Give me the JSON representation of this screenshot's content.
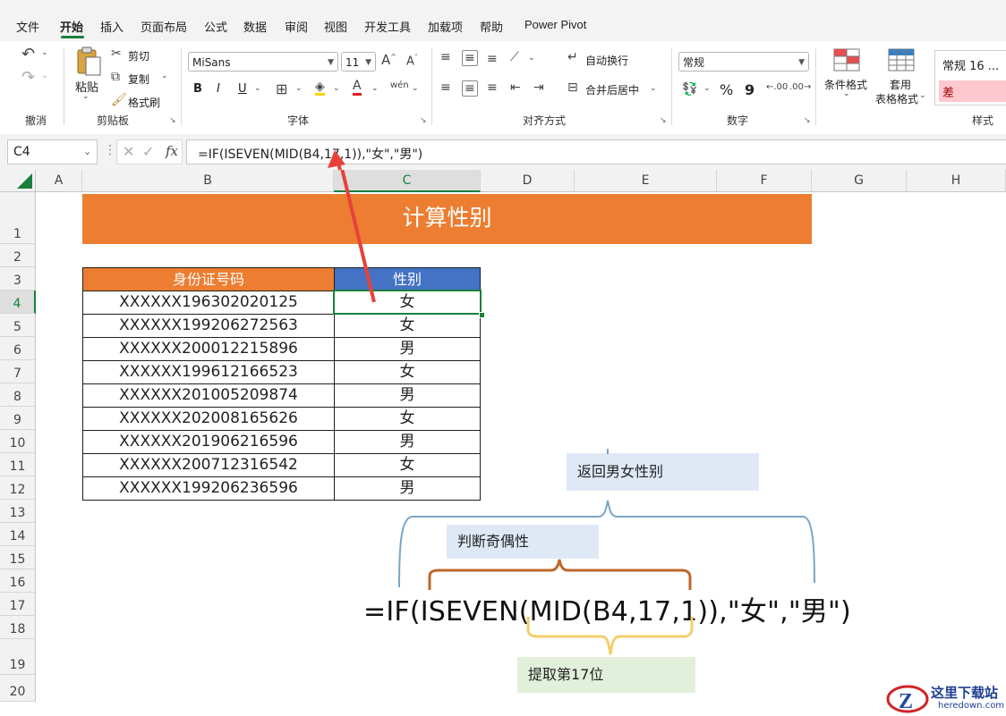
{
  "menu": {
    "tabs": [
      "文件",
      "开始",
      "插入",
      "页面布局",
      "公式",
      "数据",
      "审阅",
      "视图",
      "开发工具",
      "加载项",
      "帮助",
      "Power Pivot"
    ],
    "active": "开始"
  },
  "ribbon": {
    "undo_group": "撤消",
    "clipboard": {
      "paste": "粘贴",
      "cut": "剪切",
      "copy": "复制",
      "format_painter": "格式刷",
      "label": "剪贴板"
    },
    "font": {
      "name": "MiSans",
      "size": "11",
      "bold": "B",
      "italic": "I",
      "underline": "U",
      "label": "字体"
    },
    "alignment": {
      "wrap": "自动换行",
      "merge": "合并后居中",
      "label": "对齐方式"
    },
    "number": {
      "format": "常规",
      "percent": "%",
      "comma": "9",
      "label": "数字"
    },
    "styles": {
      "conditional": "条件格式",
      "table_line1": "套用",
      "table_line2": "表格格式",
      "normal_style": "常规 16 ...",
      "bad_style": "差",
      "label": "样式"
    }
  },
  "formula_bar": {
    "name_box": "C4",
    "fx": "fx",
    "formula": "=IF(ISEVEN(MID(B4,17,1)),\"女\",\"男\")"
  },
  "columns": [
    "A",
    "B",
    "C",
    "D",
    "E",
    "F",
    "G",
    "H"
  ],
  "rows": [
    "1",
    "2",
    "3",
    "4",
    "5",
    "6",
    "7",
    "8",
    "9",
    "10",
    "11",
    "12",
    "13",
    "14",
    "15",
    "16",
    "17",
    "18",
    "19",
    "20"
  ],
  "sheet": {
    "title": "计算性别",
    "header_id": "身份证号码",
    "header_gender": "性别",
    "records": [
      {
        "id": "XXXXXX196302020125",
        "gender": "女"
      },
      {
        "id": "XXXXXX199206272563",
        "gender": "女"
      },
      {
        "id": "XXXXXX200012215896",
        "gender": "男"
      },
      {
        "id": "XXXXXX199612166523",
        "gender": "女"
      },
      {
        "id": "XXXXXX201005209874",
        "gender": "男"
      },
      {
        "id": "XXXXXX202008165626",
        "gender": "女"
      },
      {
        "id": "XXXXXX201906216596",
        "gender": "男"
      },
      {
        "id": "XXXXXX200712316542",
        "gender": "女"
      },
      {
        "id": "XXXXXX199206236596",
        "gender": "男"
      }
    ]
  },
  "annotations": {
    "return_gender": "返回男女性别",
    "parity": "判断奇偶性",
    "extract": "提取第17位",
    "formula": "=IF(ISEVEN(MID(B4,17,1)),\"女\",\"男\")"
  },
  "watermark": {
    "name": "这里下载站",
    "url": "heredown.com"
  },
  "colors": {
    "title_bg": "#ed7d31",
    "header_id_bg": "#ed7d31",
    "header_gender_bg": "#4472c4",
    "accent_green": "#1a7f3c",
    "arrow_red": "#e8413a",
    "callout_blue_bg": "#dfe9f5",
    "callout_green_bg": "#e2efda",
    "brace_blue": "#7aa6c7",
    "brace_brown": "#c0662a",
    "brace_yellow": "#f2cf6b"
  }
}
